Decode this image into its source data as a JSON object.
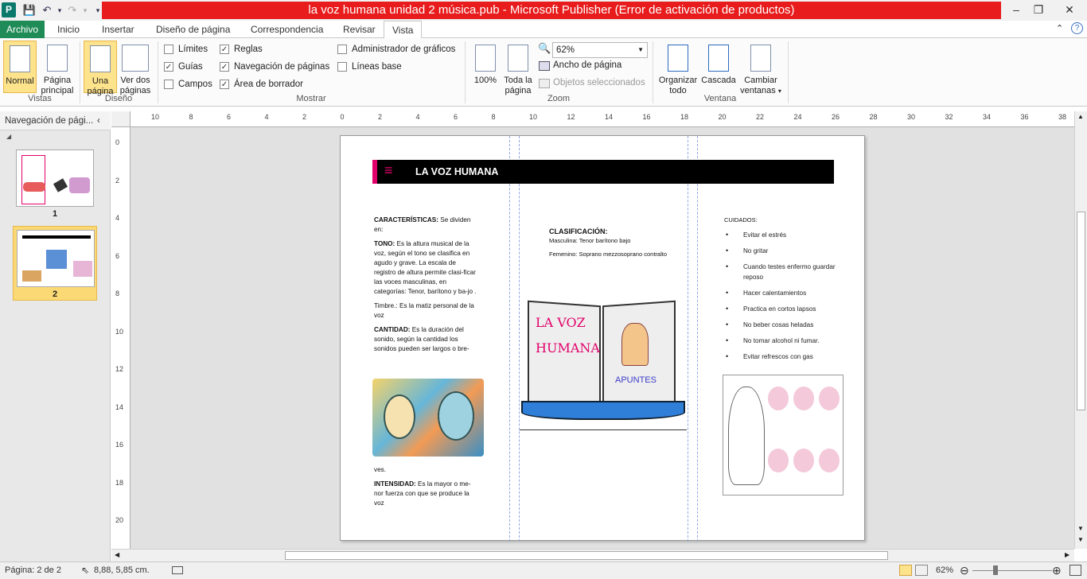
{
  "window": {
    "title": "la voz humana unidad 2 música.pub - Microsoft Publisher (Error de activación de productos)"
  },
  "tabs": [
    "Archivo",
    "Inicio",
    "Insertar",
    "Diseño de página",
    "Correspondencia",
    "Revisar",
    "Vista"
  ],
  "ribbon": {
    "vistas": {
      "label": "Vistas",
      "normal": "Normal",
      "pagina_principal_1": "Página",
      "pagina_principal_2": "principal"
    },
    "diseno": {
      "label": "Diseño",
      "una_1": "Una",
      "una_2": "página",
      "dos_1": "Ver dos",
      "dos_2": "páginas"
    },
    "mostrar": {
      "label": "Mostrar",
      "limites": "Límites",
      "guias": "Guías",
      "campos": "Campos",
      "reglas": "Reglas",
      "navegacion": "Navegación de páginas",
      "borrador": "Área de borrador",
      "graficos": "Administrador de gráficos",
      "lineas": "Líneas base"
    },
    "zoom": {
      "label": "Zoom",
      "cien": "100%",
      "toda_1": "Toda la",
      "toda_2": "página",
      "value": "62%",
      "ancho": "Ancho de página",
      "objetos": "Objetos seleccionados"
    },
    "ventana": {
      "label": "Ventana",
      "organizar_1": "Organizar",
      "organizar_2": "todo",
      "cascada": "Cascada",
      "cambiar_1": "Cambiar",
      "cambiar_2": "ventanas"
    }
  },
  "nav": {
    "title": "Navegación de pági...",
    "page1": "1",
    "page2": "2"
  },
  "ruler_top": [
    "10",
    "8",
    "6",
    "4",
    "2",
    "0",
    "2",
    "4",
    "6",
    "8",
    "10",
    "12",
    "14",
    "16",
    "18",
    "20",
    "22",
    "24",
    "26",
    "28",
    "30",
    "32",
    "34",
    "36",
    "38"
  ],
  "ruler_left": [
    "0",
    "2",
    "4",
    "6",
    "8",
    "10",
    "12",
    "14",
    "16",
    "18",
    "20"
  ],
  "doc": {
    "title": "LA VOZ HUMANA",
    "col1": {
      "p1_b": "CARACTERÍSTICAS:",
      "p1": " Se dividen en:",
      "p2_b": "TONO:",
      "p2": " Es la  altura musical de la voz, según el tono  se clasifica en agudo y grave. La escala de registro  de altura permite clasi-ficar las voces masculinas, en categorías: Tenor, barítono y ba-jo .",
      "p3": "Timbre.: Es la matiz personal de la voz",
      "p4_b": "CANTIDAD:",
      "p4": " Es la duración del sonido, según la cantidad los sonidos pueden ser largos o bre-",
      "p5": "ves.",
      "p6_b": "INTENSIDAD:",
      "p6": " Es la mayor o me-nor fuerza con que se produce la voz"
    },
    "col2": {
      "heading": "CLASIFICACIÓN:",
      "masc": "Masculina:  Tenor barítono bajo",
      "fem": "Femenino:  Soprano mezzosoprano contralto",
      "book_line1": "LA  VOZ",
      "book_line2": "HUMANA",
      "book_apuntes": "APUNTES"
    },
    "col3": {
      "heading": "CUIDADOS:",
      "items": [
        "Evitar el estrés",
        "No gritar",
        "Cuando testes enfermo guardar reposo",
        "Hacer calentamientos",
        "Practica en cortos lapsos",
        "No beber cosas heladas",
        "No tomar alcohol ni fumar.",
        "Evitar refrescos con gas"
      ]
    }
  },
  "status": {
    "page": "Página: 2 de 2",
    "position": "8,88, 5,85 cm.",
    "zoom": "62%"
  }
}
